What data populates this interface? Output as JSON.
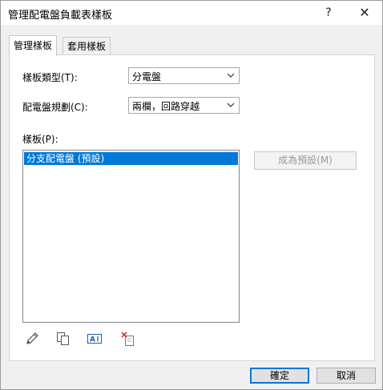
{
  "window": {
    "title": "管理配電盤負載表樣板",
    "help_label": "?",
    "close_label": "✕"
  },
  "tabs": [
    {
      "label": "管理樣板"
    },
    {
      "label": "套用樣板"
    }
  ],
  "form": {
    "template_type_label": "樣板類型(T):",
    "template_type_value": "分電盤",
    "panel_schedule_label": "配電盤規劃(C):",
    "panel_schedule_value": "兩欄，回路穿越",
    "templates_label": "樣板(P):"
  },
  "templates_list": {
    "items": [
      "分支配電盤 (預設)"
    ],
    "selected_index": 0
  },
  "buttons": {
    "set_default": "成為預設(M)",
    "ok": "確定",
    "cancel": "取消"
  },
  "toolbar": {
    "icons": [
      "pencil-icon",
      "duplicate-icon",
      "rename-icon",
      "delete-icon"
    ]
  },
  "colors": {
    "accent": "#0078d7",
    "dialog_bg": "#f0f0f0",
    "panel_bg": "#ffffff"
  }
}
